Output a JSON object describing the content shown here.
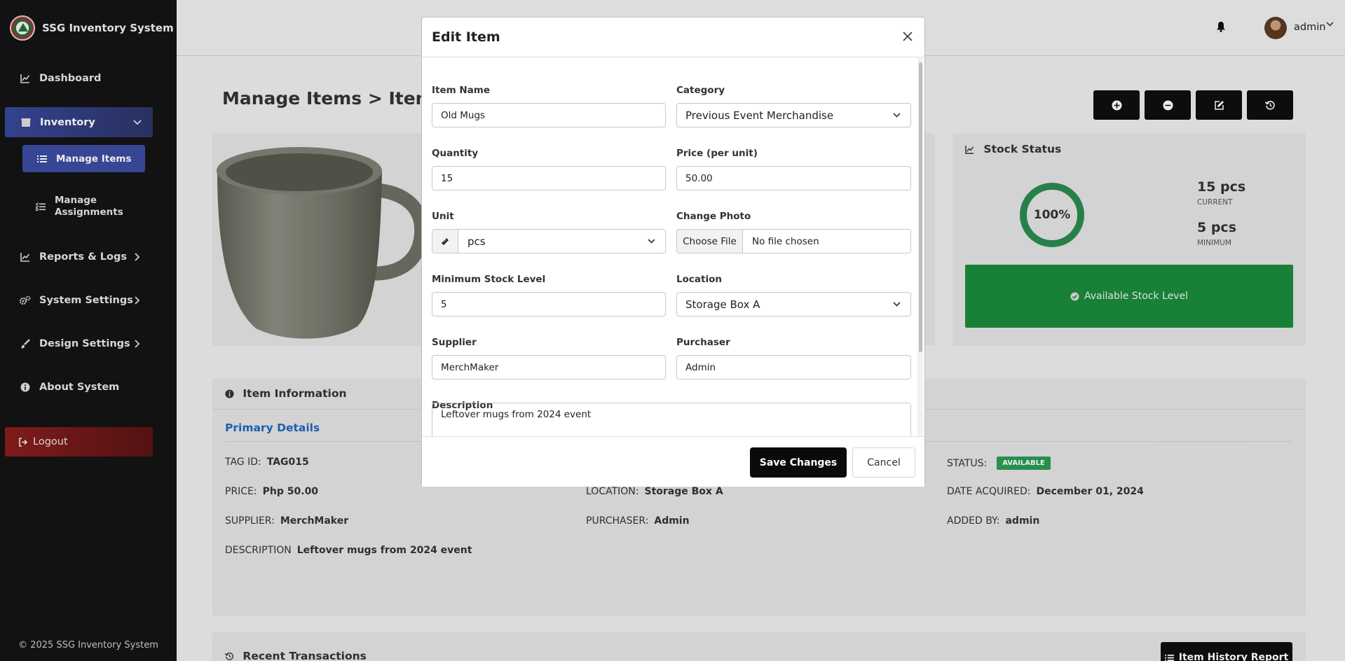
{
  "app": {
    "name": "SSG Inventory System",
    "copyright": "© 2025 SSG Inventory System"
  },
  "sidebar": {
    "items": [
      {
        "label": "Dashboard",
        "icon": "chart-line-icon"
      },
      {
        "label": "Inventory",
        "icon": "box-icon"
      },
      {
        "label": "Manage Items",
        "icon": "list-icon"
      },
      {
        "label": "Manage Assignments",
        "icon": "tasks-icon"
      },
      {
        "label": "Reports & Logs",
        "icon": "chart-line-icon"
      },
      {
        "label": "System Settings",
        "icon": "gears-icon"
      },
      {
        "label": "Design Settings",
        "icon": "brush-icon"
      },
      {
        "label": "About System",
        "icon": "info-icon"
      },
      {
        "label": "Logout",
        "icon": "sign-out-icon"
      }
    ]
  },
  "topbar": {
    "user_name": "admin"
  },
  "page": {
    "title": "Manage Items > Item Det"
  },
  "stock_status": {
    "title": "Stock Status",
    "percent": "100%",
    "current_value": "15 pcs",
    "current_label": "CURRENT",
    "minimum_value": "5 pcs",
    "minimum_label": "MINIMUM",
    "status_text": "Available Stock Level",
    "colors": {
      "donut": "#2a8a50",
      "available": "#1a8a3c"
    }
  },
  "item_info": {
    "title": "Item Information",
    "section": "Primary Details",
    "tag_id_label": "TAG ID:",
    "tag_id": "TAG015",
    "status_label": "STATUS:",
    "status": "AVAILABLE",
    "price_label": "PRICE:",
    "price": "Php 50.00",
    "location_label": "LOCATION:",
    "location": "Storage Box A",
    "date_label": "DATE ACQUIRED:",
    "date": "December 01, 2024",
    "supplier_label": "SUPPLIER:",
    "supplier": "MerchMaker",
    "purchaser_label": "PURCHASER:",
    "purchaser": "Admin",
    "added_by_label": "ADDED BY:",
    "added_by": "admin",
    "description_label": "DESCRIPTION",
    "description": "Leftover mugs from 2024 event"
  },
  "transactions": {
    "title": "Recent Transactions",
    "report_button": "Item History Report"
  },
  "modal": {
    "title": "Edit Item",
    "item_name_label": "Item Name",
    "item_name": "Old Mugs",
    "category_label": "Category",
    "category": "Previous Event Merchandise",
    "quantity_label": "Quantity",
    "quantity": "15",
    "price_label": "Price (per unit)",
    "price": "50.00",
    "unit_label": "Unit",
    "unit": "pcs",
    "photo_label": "Change Photo",
    "choose_file": "Choose File",
    "file_status": "No file chosen",
    "min_stock_label": "Minimum Stock Level",
    "min_stock": "5",
    "location_label": "Location",
    "location": "Storage Box A",
    "supplier_label": "Supplier",
    "supplier": "MerchMaker",
    "purchaser_label": "Purchaser",
    "purchaser": "Admin",
    "description_label": "Description",
    "description": "Leftover mugs from 2024 event",
    "save_button": "Save Changes",
    "cancel_button": "Cancel"
  }
}
